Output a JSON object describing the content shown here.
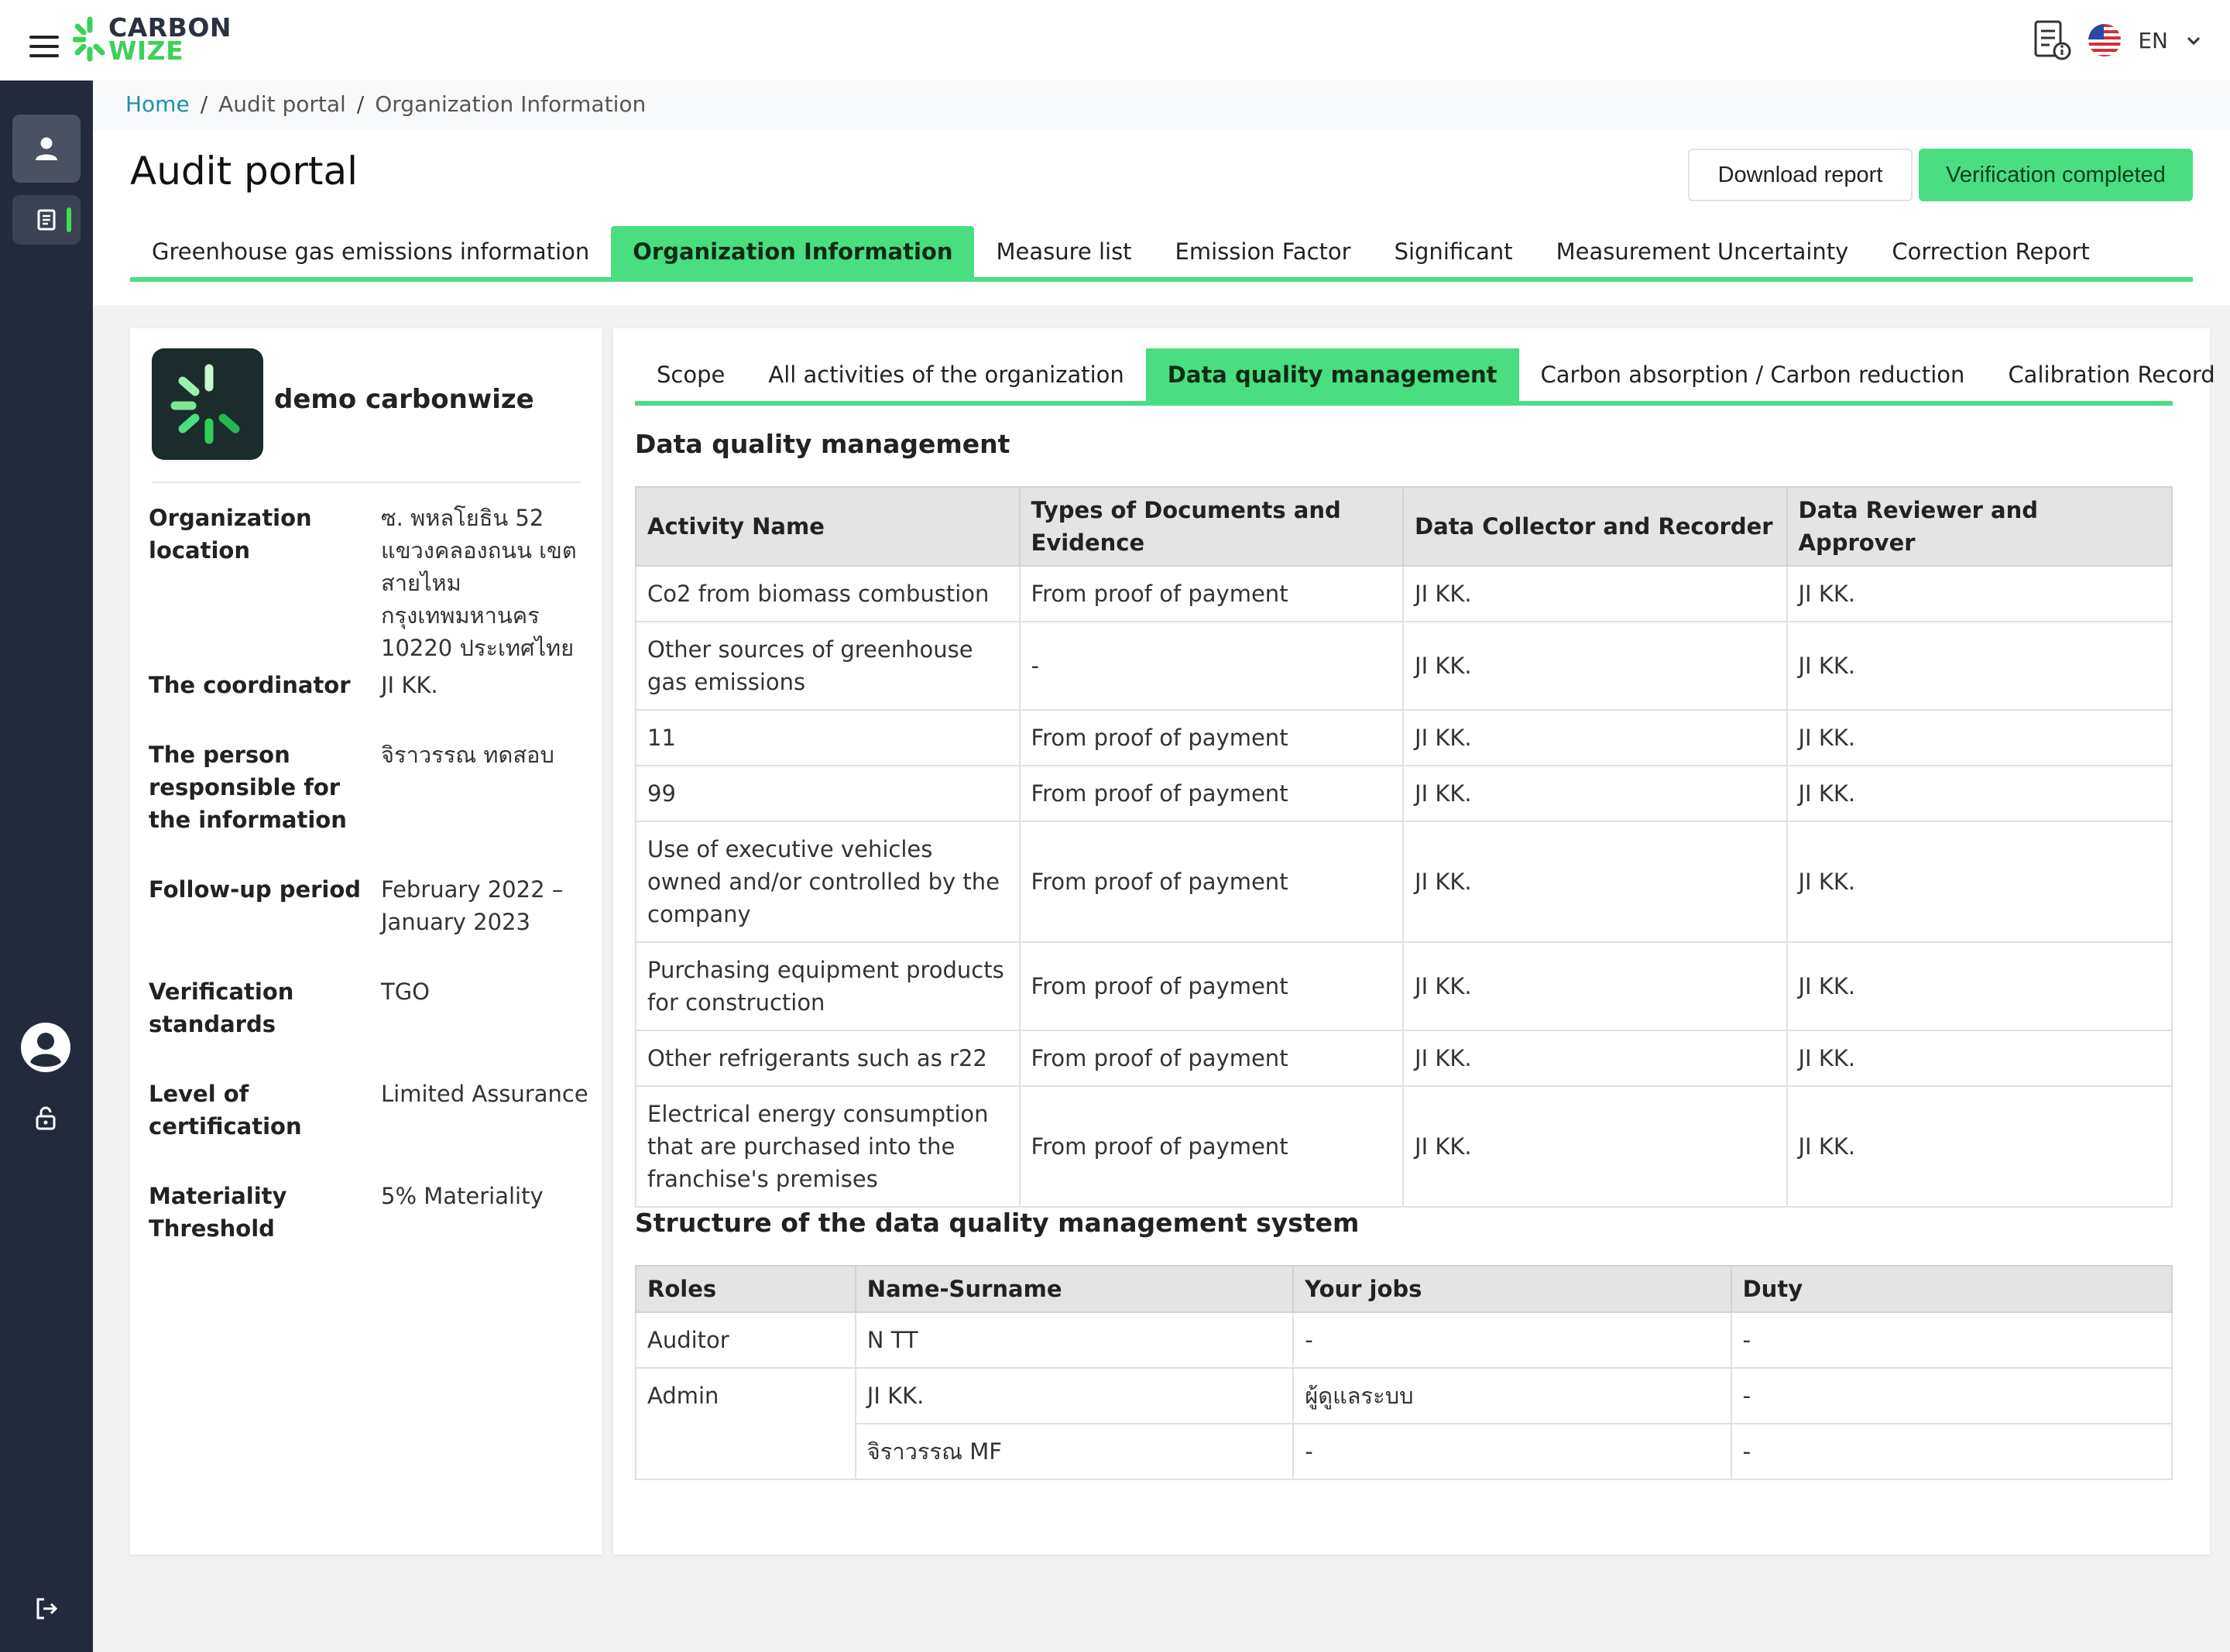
{
  "app": {
    "logo_line1": "CARBON",
    "logo_line2": "WIZE",
    "language": "EN",
    "brand_color": "#4ade80",
    "sidebar_color": "#232a3b"
  },
  "breadcrumb": [
    "Home",
    "Audit portal",
    "Organization Information"
  ],
  "page": {
    "title": "Audit portal",
    "download_label": "Download report",
    "verify_label": "Verification completed"
  },
  "main_tabs": [
    "Greenhouse gas emissions information",
    "Organization Information",
    "Measure list",
    "Emission Factor",
    "Significant",
    "Measurement Uncertainty",
    "Correction Report"
  ],
  "main_tab_active": "Organization Information",
  "organization": {
    "name": "demo carbonwize",
    "fields": [
      {
        "label": "Organization location",
        "value": "ซ. พหลโยธิน 52 แขวงคลองถนน เขตสายไหม กรุงเทพมหานคร 10220 ประเทศไทย"
      },
      {
        "label": "The coordinator",
        "value": "JI KK."
      },
      {
        "label": "The person responsible for the information",
        "value": "จิราวรรณ ทดสอบ"
      },
      {
        "label": "Follow-up period",
        "value": "February 2022 – January 2023"
      },
      {
        "label": "Verification standards",
        "value": "TGO"
      },
      {
        "label": "Level of certification",
        "value": "Limited Assurance"
      },
      {
        "label": "Materiality Threshold",
        "value": "5% Materiality"
      }
    ]
  },
  "sub_tabs": [
    "Scope",
    "All activities of the organization",
    "Data quality management",
    "Carbon absorption / Carbon reduction",
    "Calibration Record"
  ],
  "sub_tab_active": "Data quality management",
  "dq_section": {
    "title": "Data quality management",
    "headers": [
      "Activity Name",
      "Types of Documents and Evidence",
      "Data Collector and Recorder",
      "Data Reviewer and Approver"
    ],
    "rows": [
      [
        "Co2 from biomass combustion",
        "From proof of payment",
        "JI KK.",
        "JI KK."
      ],
      [
        "Other sources of greenhouse gas emissions",
        "-",
        "JI KK.",
        "JI KK."
      ],
      [
        "11",
        "From proof of payment",
        "JI KK.",
        "JI KK."
      ],
      [
        "99",
        "From proof of payment",
        "JI KK.",
        "JI KK."
      ],
      [
        "Use of executive vehicles owned and/or controlled by the company",
        "From proof of payment",
        "JI KK.",
        "JI KK."
      ],
      [
        "Purchasing equipment products for construction",
        "From proof of payment",
        "JI KK.",
        "JI KK."
      ],
      [
        "Other refrigerants such as r22",
        "From proof of payment",
        "JI KK.",
        "JI KK."
      ],
      [
        "Electrical energy consumption that are purchased into the franchise's premises",
        "From proof of payment",
        "JI KK.",
        "JI KK."
      ]
    ]
  },
  "structure_section": {
    "title": "Structure of the data quality management system",
    "headers": [
      "Roles",
      "Name-Surname",
      "Your jobs",
      "Duty"
    ],
    "rows": [
      {
        "role": "Auditor",
        "name": "N TT",
        "jobs": "-",
        "duty": "-"
      },
      {
        "role": "Admin",
        "name": "JI KK.",
        "jobs": "ผู้ดูแลระบบ",
        "duty": "-"
      },
      {
        "role": "",
        "name": "จิราวรรณ MF",
        "jobs": "-",
        "duty": "-"
      }
    ]
  }
}
